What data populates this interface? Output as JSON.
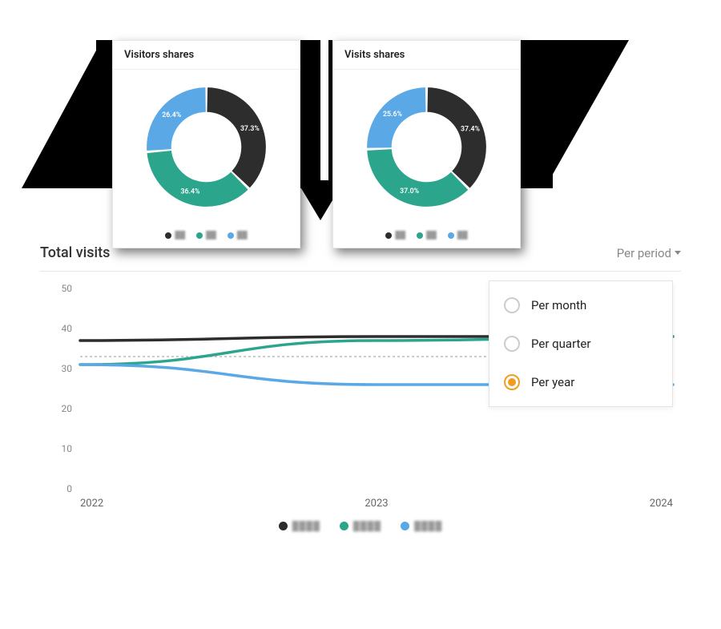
{
  "colors": {
    "dark": "#2d2d2d",
    "green": "#2ca58d",
    "blue": "#5aa9e6",
    "accent": "#f29c1f"
  },
  "donuts": [
    {
      "title": "Visitors shares",
      "slices": [
        {
          "label": "37.3%",
          "value": 37.3,
          "color": "#2d2d2d"
        },
        {
          "label": "36.4%",
          "value": 36.4,
          "color": "#2ca58d"
        },
        {
          "label": "26.4%",
          "value": 26.4,
          "color": "#5aa9e6"
        }
      ]
    },
    {
      "title": "Visits shares",
      "slices": [
        {
          "label": "37.4%",
          "value": 37.4,
          "color": "#2d2d2d"
        },
        {
          "label": "37.0%",
          "value": 37.0,
          "color": "#2ca58d"
        },
        {
          "label": "25.6%",
          "value": 25.6,
          "color": "#5aa9e6"
        }
      ]
    }
  ],
  "line_section": {
    "title": "Total visits",
    "trigger_label": "Per period",
    "options": [
      {
        "label": "Per month",
        "selected": false
      },
      {
        "label": "Per quarter",
        "selected": false
      },
      {
        "label": "Per year",
        "selected": true
      }
    ]
  },
  "chart_data": [
    {
      "type": "pie",
      "title": "Visitors shares",
      "series": [
        {
          "name": "A",
          "value": 37.3
        },
        {
          "name": "B",
          "value": 36.4
        },
        {
          "name": "C",
          "value": 26.4
        }
      ]
    },
    {
      "type": "pie",
      "title": "Visits shares",
      "series": [
        {
          "name": "A",
          "value": 37.4
        },
        {
          "name": "B",
          "value": 37.0
        },
        {
          "name": "C",
          "value": 25.6
        }
      ]
    },
    {
      "type": "line",
      "title": "Total visits",
      "xlabel": "",
      "ylabel": "",
      "ylim": [
        0,
        50
      ],
      "yticks": [
        0,
        10,
        20,
        30,
        40,
        50
      ],
      "x": [
        "2022",
        "2023",
        "2024"
      ],
      "dotted_reference": 33,
      "series": [
        {
          "name": "A",
          "color": "#2d2d2d",
          "values": [
            37,
            38,
            38
          ]
        },
        {
          "name": "B",
          "color": "#2ca58d",
          "values": [
            31,
            37,
            38
          ]
        },
        {
          "name": "C",
          "color": "#5aa9e6",
          "values": [
            31,
            26,
            26
          ]
        }
      ]
    }
  ]
}
